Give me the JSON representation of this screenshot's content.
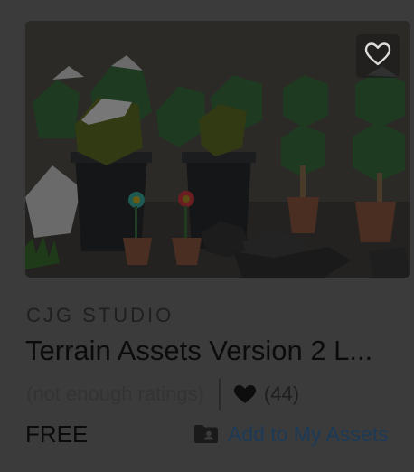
{
  "asset": {
    "publisher": "CJG STUDIO",
    "title": "Terrain Assets Version 2 L...",
    "rating_text": "(not enough ratings)",
    "favorites_count": "(44)",
    "price": "FREE",
    "add_label": "Add to My Assets"
  },
  "icons": {
    "favorite": "heart-outline-icon",
    "favorites_count": "heart-filled-icon",
    "add": "folder-user-icon"
  },
  "colors": {
    "background": "#3b3b3b",
    "link": "#1b3a57",
    "thumbnail_bg": "#2a2825"
  }
}
